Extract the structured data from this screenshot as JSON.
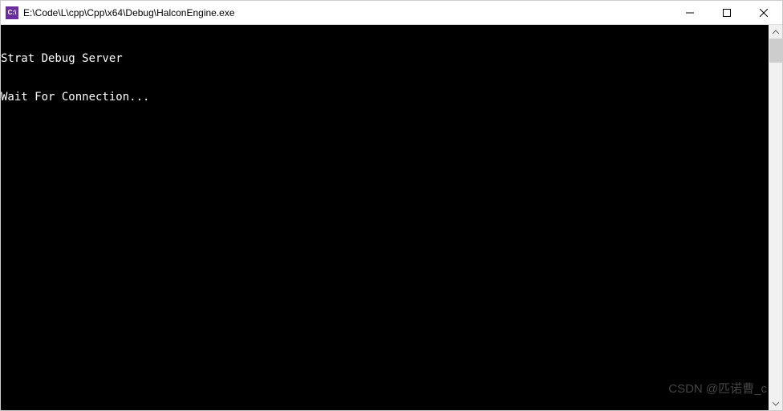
{
  "window": {
    "title": "E:\\Code\\L\\cpp\\Cpp\\x64\\Debug\\HalconEngine.exe",
    "icon_label": "C:\\"
  },
  "console": {
    "lines": [
      "Strat Debug Server",
      "Wait For Connection..."
    ]
  },
  "watermark": "CSDN @匹诺曹_c",
  "colors": {
    "console_bg": "#000000",
    "console_fg": "#ffffff",
    "titlebar_bg": "#ffffff",
    "icon_bg": "#6b2e9e"
  }
}
